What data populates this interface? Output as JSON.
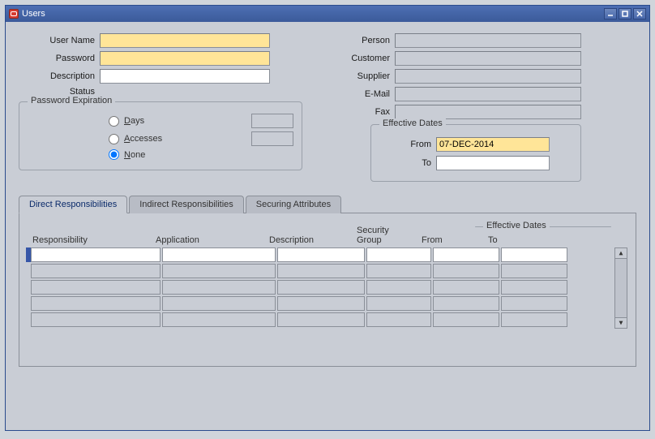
{
  "window": {
    "title": "Users"
  },
  "form": {
    "labels": {
      "user_name": "User Name",
      "password": "Password",
      "description": "Description",
      "status": "Status",
      "person": "Person",
      "customer": "Customer",
      "supplier": "Supplier",
      "email": "E-Mail",
      "fax": "Fax"
    },
    "values": {
      "user_name": "",
      "password": "",
      "description": "",
      "status": "",
      "person": "",
      "customer": "",
      "supplier": "",
      "email": "",
      "fax": ""
    }
  },
  "password_expiration": {
    "legend": "Password Expiration",
    "options": {
      "days": "Days",
      "accesses": "Accesses",
      "none": "None"
    },
    "selected": "none",
    "days_value": "",
    "accesses_value": ""
  },
  "effective_dates": {
    "legend": "Effective Dates",
    "from_label": "From",
    "to_label": "To",
    "from": "07-DEC-2014",
    "to": ""
  },
  "tabs": {
    "direct": "Direct Responsibilities",
    "indirect": "Indirect Responsibilities",
    "securing": "Securing Attributes",
    "active": "direct"
  },
  "grid": {
    "headers": {
      "responsibility": "Responsibility",
      "application": "Application",
      "description": "Description",
      "security_group": "Security\nGroup",
      "effective_dates": "Effective Dates",
      "from": "From",
      "to": "To"
    },
    "rows": [
      {
        "responsibility": "",
        "application": "",
        "description": "",
        "security_group": "",
        "from": "",
        "to": "",
        "current": true
      },
      {
        "responsibility": "",
        "application": "",
        "description": "",
        "security_group": "",
        "from": "",
        "to": "",
        "current": false
      },
      {
        "responsibility": "",
        "application": "",
        "description": "",
        "security_group": "",
        "from": "",
        "to": "",
        "current": false
      },
      {
        "responsibility": "",
        "application": "",
        "description": "",
        "security_group": "",
        "from": "",
        "to": "",
        "current": false
      },
      {
        "responsibility": "",
        "application": "",
        "description": "",
        "security_group": "",
        "from": "",
        "to": "",
        "current": false
      }
    ]
  }
}
